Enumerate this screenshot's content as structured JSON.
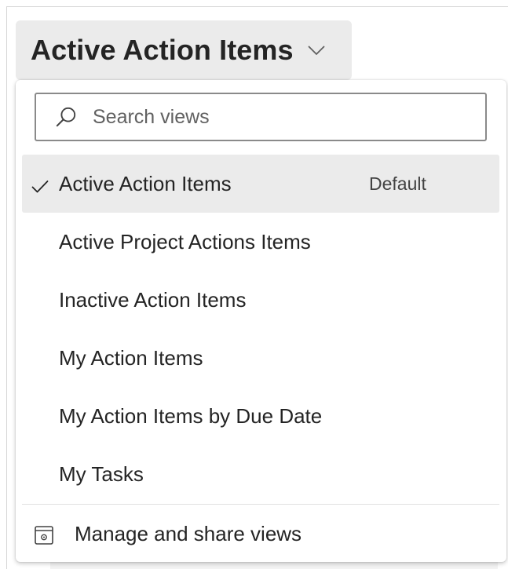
{
  "view_selector": {
    "current_view": "Active Action Items",
    "chevron_icon": "chevron-down-icon"
  },
  "dropdown": {
    "search": {
      "placeholder": "Search views",
      "icon": "search-icon"
    },
    "views": [
      {
        "label": "Active Action Items",
        "badge": "Default",
        "selected": true
      },
      {
        "label": "Active Project Actions Items",
        "badge": "",
        "selected": false
      },
      {
        "label": "Inactive Action Items",
        "badge": "",
        "selected": false
      },
      {
        "label": "My Action Items",
        "badge": "",
        "selected": false
      },
      {
        "label": "My Action Items by Due Date",
        "badge": "",
        "selected": false
      },
      {
        "label": "My Tasks",
        "badge": "",
        "selected": false
      }
    ],
    "manage": {
      "label": "Manage and share views",
      "icon": "manage-views-icon"
    }
  },
  "colors": {
    "selected_background": "#ebebeb",
    "text": "#242424",
    "placeholder": "#616161"
  }
}
